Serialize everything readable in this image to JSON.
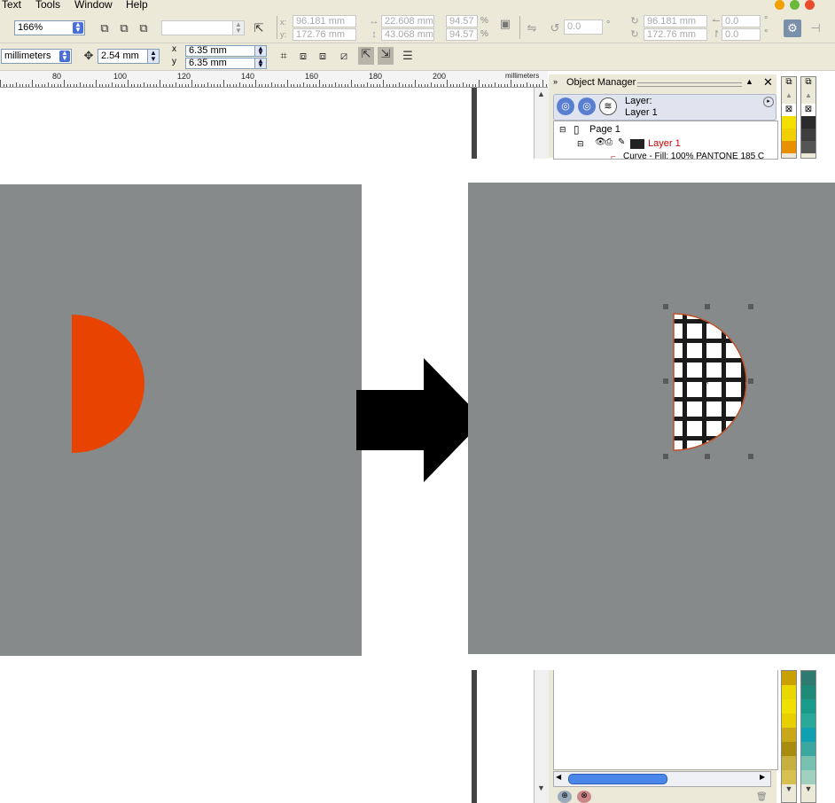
{
  "menu": {
    "items": [
      "Text",
      "Tools",
      "Window",
      "Help"
    ]
  },
  "toolbar1": {
    "zoom": "166%",
    "x_value": "96.181 mm",
    "y_value": "172.76 mm",
    "width_value": "22.608 mm",
    "height_value": "43.068 mm",
    "scale_x": "94.57",
    "scale_y": "94.57",
    "percent": "%",
    "rotation": "0.0",
    "degree": "°",
    "center_x": "96.181 mm",
    "center_y": "172.76 mm",
    "skew_h": "0.0",
    "skew_v": "0.0",
    "x_label": "x:",
    "y_label": "y:"
  },
  "toolbar2": {
    "units": "millimeters",
    "nudge": "2.54 mm",
    "dup_x": "6.35 mm",
    "dup_y": "6.35 mm",
    "x_label": "x",
    "y_label": "y"
  },
  "ruler": {
    "labels": [
      "80",
      "100",
      "120",
      "140",
      "160",
      "180",
      "200"
    ],
    "unit": "millimeters"
  },
  "docker": {
    "title": "Object Manager",
    "layer_label": "Layer:",
    "layer_name": "Layer 1",
    "page": "Page 1",
    "tree_layer": "Layer 1",
    "curve_item": "Curve - Fill: 100% PANTONE 185 C"
  },
  "colors": {
    "half_circle": "#e84300",
    "panel_bg": "#868a8a",
    "layer_red": "#cc0000"
  },
  "icons": [
    "arrow-right-icon",
    "grid-pattern-icon",
    "close-icon",
    "scroll-up-icon",
    "scroll-down-icon"
  ]
}
